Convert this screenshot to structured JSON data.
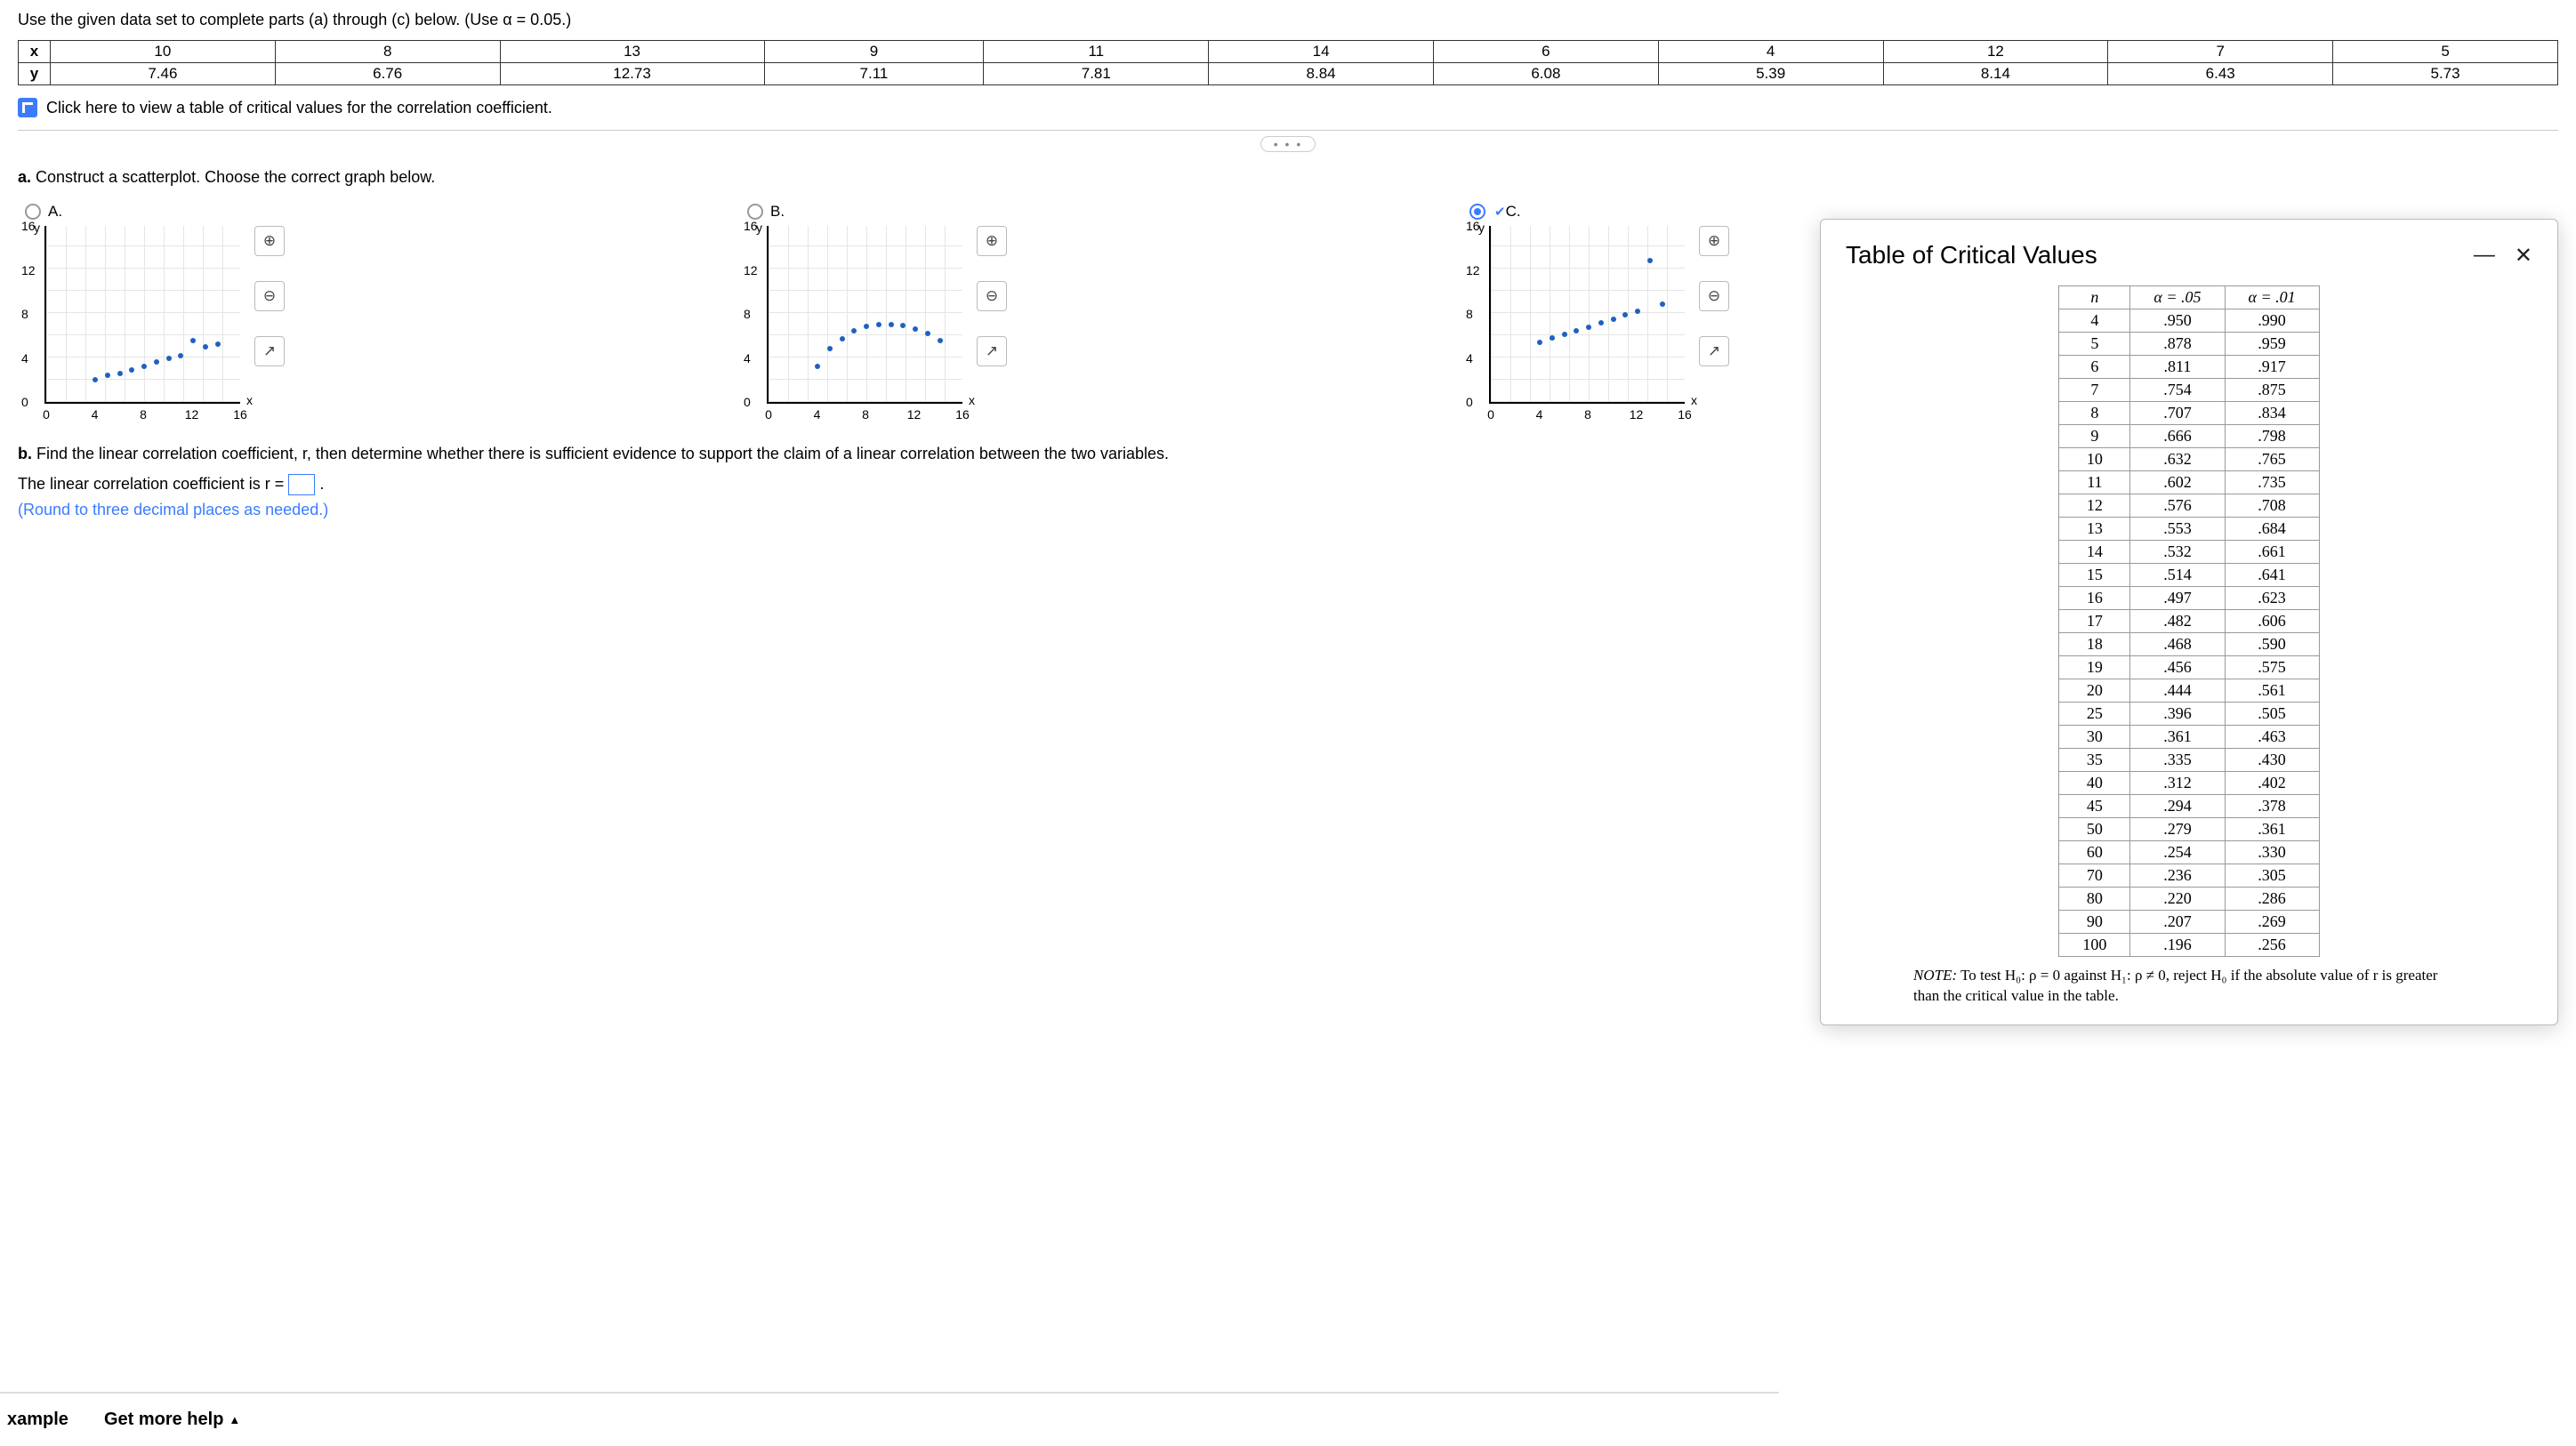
{
  "prompt": "Use the given data set to complete parts (a) through (c) below. (Use α = 0.05.)",
  "dataset": {
    "row_x_label": "x",
    "row_y_label": "y",
    "x": [
      "10",
      "8",
      "13",
      "9",
      "11",
      "14",
      "6",
      "4",
      "12",
      "7",
      "5"
    ],
    "y": [
      "7.46",
      "6.76",
      "12.73",
      "7.11",
      "7.81",
      "8.84",
      "6.08",
      "5.39",
      "8.14",
      "6.43",
      "5.73"
    ]
  },
  "link_text": "Click here to view a table of critical values for the correlation coefficient.",
  "part_a": {
    "label": "a.",
    "text": "Construct a scatterplot. Choose the correct graph below.",
    "options": [
      {
        "id": "A",
        "label": "A.",
        "selected": false,
        "correct": false
      },
      {
        "id": "B",
        "label": "B.",
        "selected": false,
        "correct": false
      },
      {
        "id": "C",
        "label": "C.",
        "selected": true,
        "correct": true
      }
    ],
    "axis": {
      "y_ticks": [
        "0",
        "4",
        "8",
        "12",
        "16"
      ],
      "x_ticks": [
        "0",
        "4",
        "8",
        "12",
        "16"
      ],
      "y_label": "y",
      "x_label": "x"
    },
    "icons": {
      "zoom_in": "⊕",
      "zoom_out": "⊖",
      "popout": "↗"
    }
  },
  "part_b": {
    "label": "b.",
    "text": "Find the linear correlation coefficient, r, then determine whether there is sufficient evidence to support the claim of a linear correlation between the two variables.",
    "answer_prefix": "The linear correlation coefficient is r =",
    "answer_postfix": ".",
    "hint": "(Round to three decimal places as needed.)"
  },
  "panel": {
    "title": "Table of Critical Values",
    "minimize": "—",
    "close": "✕",
    "headers": [
      "n",
      "α = .05",
      "α = .01"
    ],
    "rows": [
      [
        "4",
        ".950",
        ".990"
      ],
      [
        "5",
        ".878",
        ".959"
      ],
      [
        "6",
        ".811",
        ".917"
      ],
      [
        "7",
        ".754",
        ".875"
      ],
      [
        "8",
        ".707",
        ".834"
      ],
      [
        "9",
        ".666",
        ".798"
      ],
      [
        "10",
        ".632",
        ".765"
      ],
      [
        "11",
        ".602",
        ".735"
      ],
      [
        "12",
        ".576",
        ".708"
      ],
      [
        "13",
        ".553",
        ".684"
      ],
      [
        "14",
        ".532",
        ".661"
      ],
      [
        "15",
        ".514",
        ".641"
      ],
      [
        "16",
        ".497",
        ".623"
      ],
      [
        "17",
        ".482",
        ".606"
      ],
      [
        "18",
        ".468",
        ".590"
      ],
      [
        "19",
        ".456",
        ".575"
      ],
      [
        "20",
        ".444",
        ".561"
      ],
      [
        "25",
        ".396",
        ".505"
      ],
      [
        "30",
        ".361",
        ".463"
      ],
      [
        "35",
        ".335",
        ".430"
      ],
      [
        "40",
        ".312",
        ".402"
      ],
      [
        "45",
        ".294",
        ".378"
      ],
      [
        "50",
        ".279",
        ".361"
      ],
      [
        "60",
        ".254",
        ".330"
      ],
      [
        "70",
        ".236",
        ".305"
      ],
      [
        "80",
        ".220",
        ".286"
      ],
      [
        "90",
        ".207",
        ".269"
      ],
      [
        "100",
        ".196",
        ".256"
      ]
    ],
    "note_html": "NOTE: To test H₀: ρ = 0 against H₁: ρ ≠ 0, reject H₀ if the absolute value of r is greater than the critical value in the table."
  },
  "bottom": {
    "item1": "xample",
    "item2": "Get more help",
    "caret": "▲"
  },
  "chart_data": {
    "type": "scatter",
    "title": "",
    "xlabel": "x",
    "ylabel": "y",
    "xlim": [
      0,
      16
    ],
    "ylim": [
      0,
      16
    ],
    "series": [
      {
        "name": "C (correct)",
        "points": [
          [
            10,
            7.46
          ],
          [
            8,
            6.76
          ],
          [
            13,
            12.73
          ],
          [
            9,
            7.11
          ],
          [
            11,
            7.81
          ],
          [
            14,
            8.84
          ],
          [
            6,
            6.08
          ],
          [
            4,
            5.39
          ],
          [
            12,
            8.14
          ],
          [
            7,
            6.43
          ],
          [
            5,
            5.73
          ]
        ]
      },
      {
        "name": "A",
        "points": [
          [
            4,
            2.0
          ],
          [
            5,
            2.4
          ],
          [
            6,
            2.6
          ],
          [
            7,
            2.9
          ],
          [
            8,
            3.2
          ],
          [
            9,
            3.6
          ],
          [
            10,
            3.9
          ],
          [
            11,
            4.2
          ],
          [
            12,
            5.5
          ],
          [
            13,
            5.0
          ],
          [
            14,
            5.2
          ]
        ]
      },
      {
        "name": "B",
        "points": [
          [
            4,
            3.2
          ],
          [
            5,
            4.8
          ],
          [
            6,
            5.7
          ],
          [
            7,
            6.4
          ],
          [
            8,
            6.8
          ],
          [
            9,
            7.0
          ],
          [
            10,
            7.0
          ],
          [
            11,
            6.9
          ],
          [
            12,
            6.6
          ],
          [
            13,
            6.2
          ],
          [
            14,
            5.5
          ]
        ]
      }
    ]
  }
}
